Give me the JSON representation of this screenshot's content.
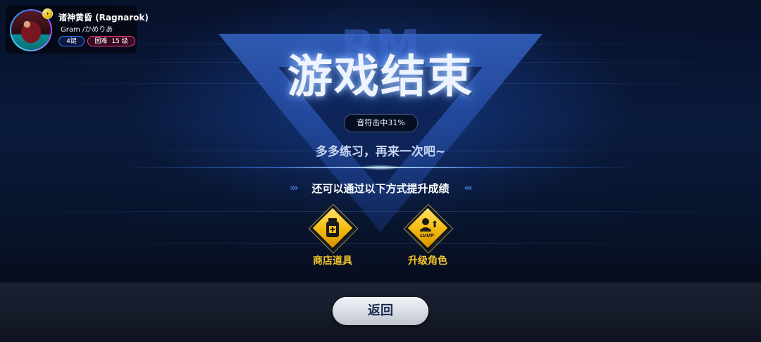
{
  "song": {
    "title": "诸神黄昏 (Ragnarok)",
    "artist": "Gram /かめりあ",
    "keys": "4键",
    "difficulty": "困难",
    "level": "15 级"
  },
  "result": {
    "title": "游戏结束",
    "hit_rate": "音符击中31%",
    "encourage": "多多练习，再来一次吧~",
    "improve_heading": "还可以通过以下方式提升成绩",
    "chevrons_left": "›››",
    "chevrons_right": "‹‹‹"
  },
  "options": [
    {
      "label": "商店道具",
      "icon": "medicine-bottle-icon"
    },
    {
      "label": "升级角色",
      "icon": "level-up-icon",
      "icon_text": "LVUP"
    }
  ],
  "buttons": {
    "back": "返回"
  },
  "background": {
    "logo_text": "RM"
  },
  "colors": {
    "accent_blue": "#3c7bff",
    "difficulty_pink": "#ff3d8a",
    "option_gold": "#f4c52a"
  }
}
